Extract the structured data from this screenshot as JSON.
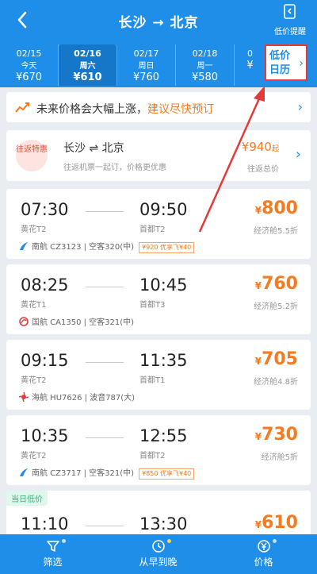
{
  "header": {
    "title": "长沙 → 北京",
    "alert_label": "低价提醒"
  },
  "date_strip": [
    {
      "date": "02/15",
      "weekday": "今天",
      "price": "¥670"
    },
    {
      "date": "02/16",
      "weekday": "周六",
      "price": "¥610"
    },
    {
      "date": "02/17",
      "weekday": "周日",
      "price": "¥760"
    },
    {
      "date": "02/18",
      "weekday": "周一",
      "price": "¥580"
    },
    {
      "date": "0",
      "weekday": "",
      "price": "¥"
    }
  ],
  "calendar": {
    "label": "低价日历"
  },
  "notice": {
    "text": "未来价格会大幅上涨，",
    "highlight": "建议尽快预订"
  },
  "round_trip": {
    "badge": "往返特惠",
    "route": "长沙 ⇌ 北京",
    "desc": "往返机票一起订，价格更优惠",
    "price": "¥940",
    "price_suffix": "起",
    "sub": "往返总价"
  },
  "flights": [
    {
      "dep_time": "07:30",
      "dep_airport": "黄花T2",
      "arr_time": "09:50",
      "arr_airport": "首都T2",
      "price_symbol": "¥",
      "price": "800",
      "cabin": "经济舱5.5折",
      "airline": "南航 CZ3123 | 空客320(中)",
      "promo": "¥920 优享飞¥40"
    },
    {
      "dep_time": "08:25",
      "dep_airport": "黄花T1",
      "arr_time": "10:45",
      "arr_airport": "首都T3",
      "price_symbol": "¥",
      "price": "760",
      "cabin": "经济舱5.2折",
      "airline": "国航 CA1350 | 空客321(中)",
      "promo": ""
    },
    {
      "dep_time": "09:15",
      "dep_airport": "黄花T2",
      "arr_time": "11:35",
      "arr_airport": "首都T1",
      "price_symbol": "¥",
      "price": "705",
      "cabin": "经济舱4.8折",
      "airline": "海航 HU7626 | 波音787(大)",
      "promo": ""
    },
    {
      "dep_time": "10:35",
      "dep_airport": "黄花T2",
      "arr_time": "12:55",
      "arr_airport": "首都T2",
      "price_symbol": "¥",
      "price": "730",
      "cabin": "经济舱5折",
      "airline": "南航 CZ3717 | 空客321(中)",
      "promo": "¥850 优享飞¥40"
    },
    {
      "tag": "当日低价",
      "dep_time": "11:10",
      "arr_time": "13:30",
      "price_symbol": "¥",
      "price": "610"
    }
  ],
  "tabs": [
    {
      "label": "筛选"
    },
    {
      "label": "从早到晚"
    },
    {
      "label": "价格"
    }
  ],
  "colors": {
    "primary": "#1f8ee8",
    "price": "#f47b1f",
    "annotation": "#e23b3b"
  }
}
